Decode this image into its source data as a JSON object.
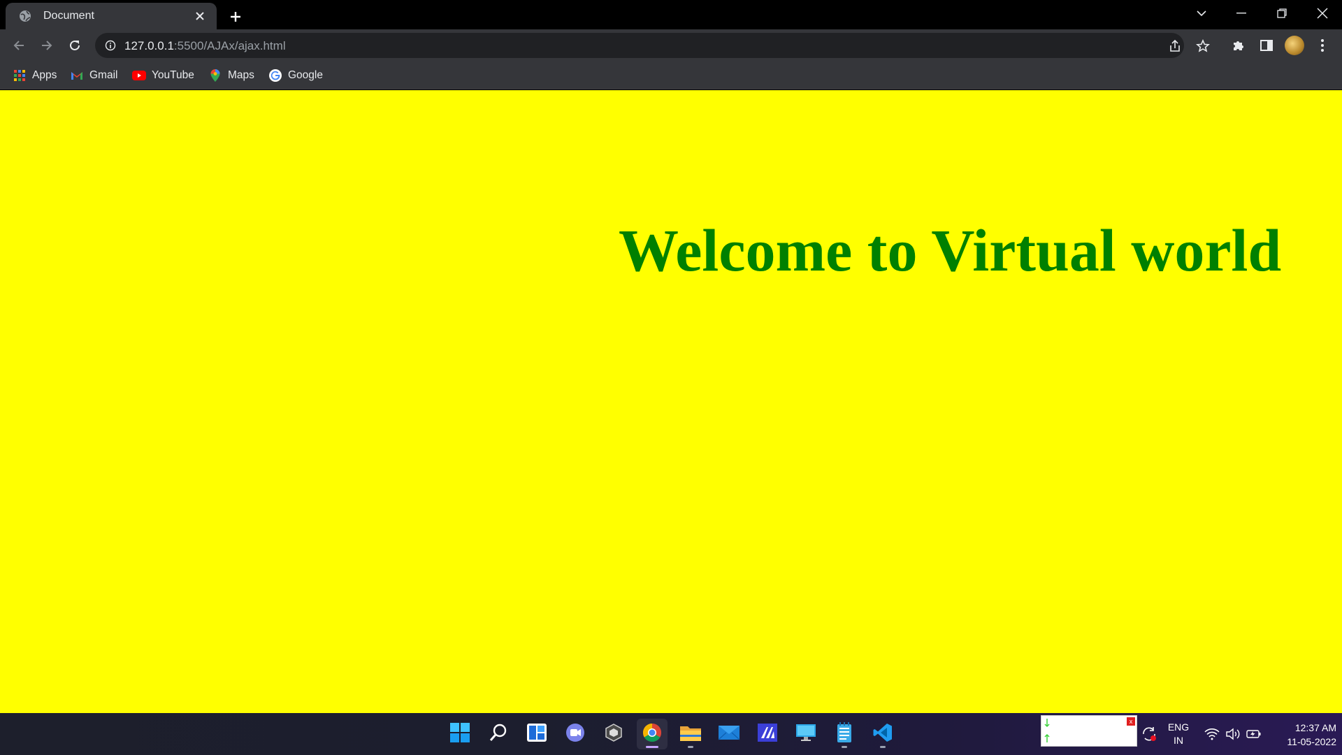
{
  "browser": {
    "tab": {
      "title": "Document"
    },
    "address": {
      "host": "127.0.0.1",
      "path": ":5500/AJAx/ajax.html"
    },
    "bookmarks": [
      {
        "label": "Apps",
        "icon": "apps-grid-icon"
      },
      {
        "label": "Gmail",
        "icon": "gmail-icon"
      },
      {
        "label": "YouTube",
        "icon": "youtube-icon"
      },
      {
        "label": "Maps",
        "icon": "maps-icon"
      },
      {
        "label": "Google",
        "icon": "google-icon"
      }
    ]
  },
  "page": {
    "heading": "Welcome to Virtual world",
    "background_color": "#ffff00",
    "heading_color": "#008000"
  },
  "taskbar": {
    "apps": [
      "start",
      "search",
      "widgets",
      "teams-chat",
      "unity",
      "chrome",
      "file-explorer",
      "mail",
      "codelite",
      "remote-desktop",
      "notepad",
      "vscode"
    ],
    "language": {
      "line1": "ENG",
      "line2": "IN"
    },
    "clock": {
      "time": "12:37 AM",
      "date": "11-05-2022"
    }
  }
}
